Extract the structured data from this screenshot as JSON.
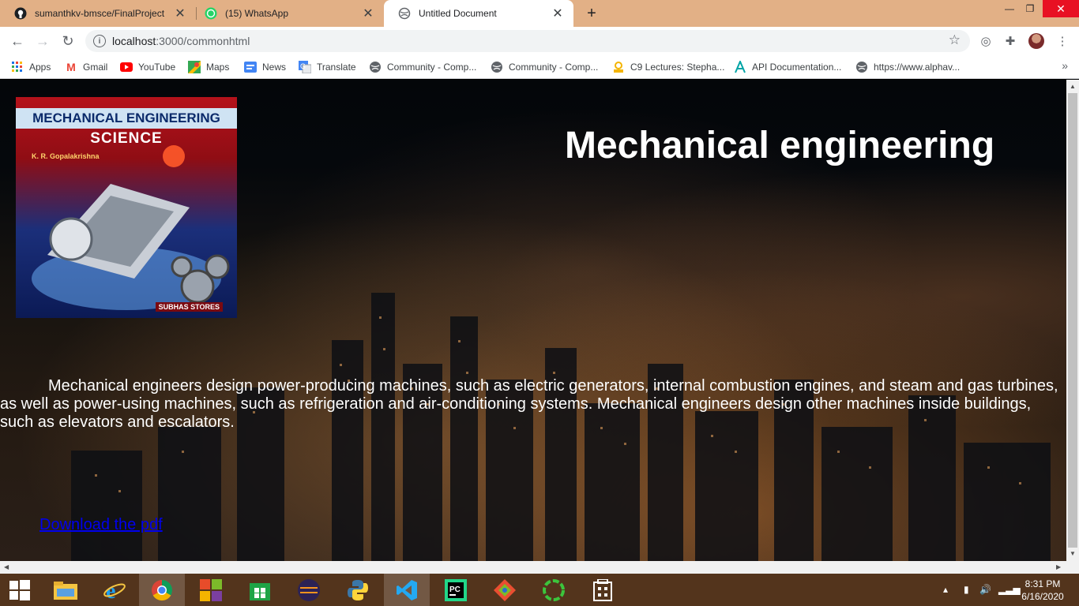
{
  "tabs": [
    {
      "title": "sumanthkv-bmsce/FinalProject",
      "icon": "github-icon"
    },
    {
      "title": "(15) WhatsApp",
      "icon": "whatsapp-icon",
      "badge": "15"
    },
    {
      "title": "Untitled Document",
      "icon": "globe-icon",
      "active": true
    }
  ],
  "address_bar": {
    "host": "localhost",
    "path": ":3000/commonhtml"
  },
  "bookmarks": [
    {
      "label": "Apps",
      "icon": "apps-grid-icon"
    },
    {
      "label": "Gmail",
      "icon": "gmail-icon"
    },
    {
      "label": "YouTube",
      "icon": "youtube-icon"
    },
    {
      "label": "Maps",
      "icon": "maps-icon"
    },
    {
      "label": "News",
      "icon": "news-icon"
    },
    {
      "label": "Translate",
      "icon": "translate-icon"
    },
    {
      "label": "Community - Comp...",
      "icon": "globe-icon"
    },
    {
      "label": "Community - Comp...",
      "icon": "globe-icon"
    },
    {
      "label": "C9 Lectures: Stepha...",
      "icon": "c9-icon"
    },
    {
      "label": "API Documentation...",
      "icon": "api-icon"
    },
    {
      "label": "https://www.alphav...",
      "icon": "globe-icon"
    }
  ],
  "page": {
    "heading": "Mechanical engineering",
    "cover": {
      "title_line1": "MECHANICAL ENGINEERING",
      "title_line2": "SCIENCE",
      "author": "K. R. Gopalakrishna",
      "publisher": "SUBHAS STORES"
    },
    "paragraph": "Mechanical engineers design power-producing machines, such as electric generators, internal combustion engines, and steam and gas turbines, as well as power-using machines, such as refrigeration and air-conditioning systems. Mechanical engineers design other machines inside buildings, such as elevators and escalators.",
    "download_link": "Download the pdf"
  },
  "taskbar": {
    "apps": [
      "windows-start-icon",
      "file-explorer-icon",
      "internet-explorer-icon",
      "chrome-icon",
      "office-icon",
      "store-icon",
      "eclipse-icon",
      "python-icon",
      "vscode-icon",
      "pycharm-icon",
      "git-icon",
      "spinner-app-icon",
      "calculator-icon"
    ],
    "time": "8:31 PM",
    "date": "6/16/2020"
  },
  "colors": {
    "tab_strip": "#e2b086",
    "link": "#0000ee",
    "taskbar": "#53341c"
  }
}
